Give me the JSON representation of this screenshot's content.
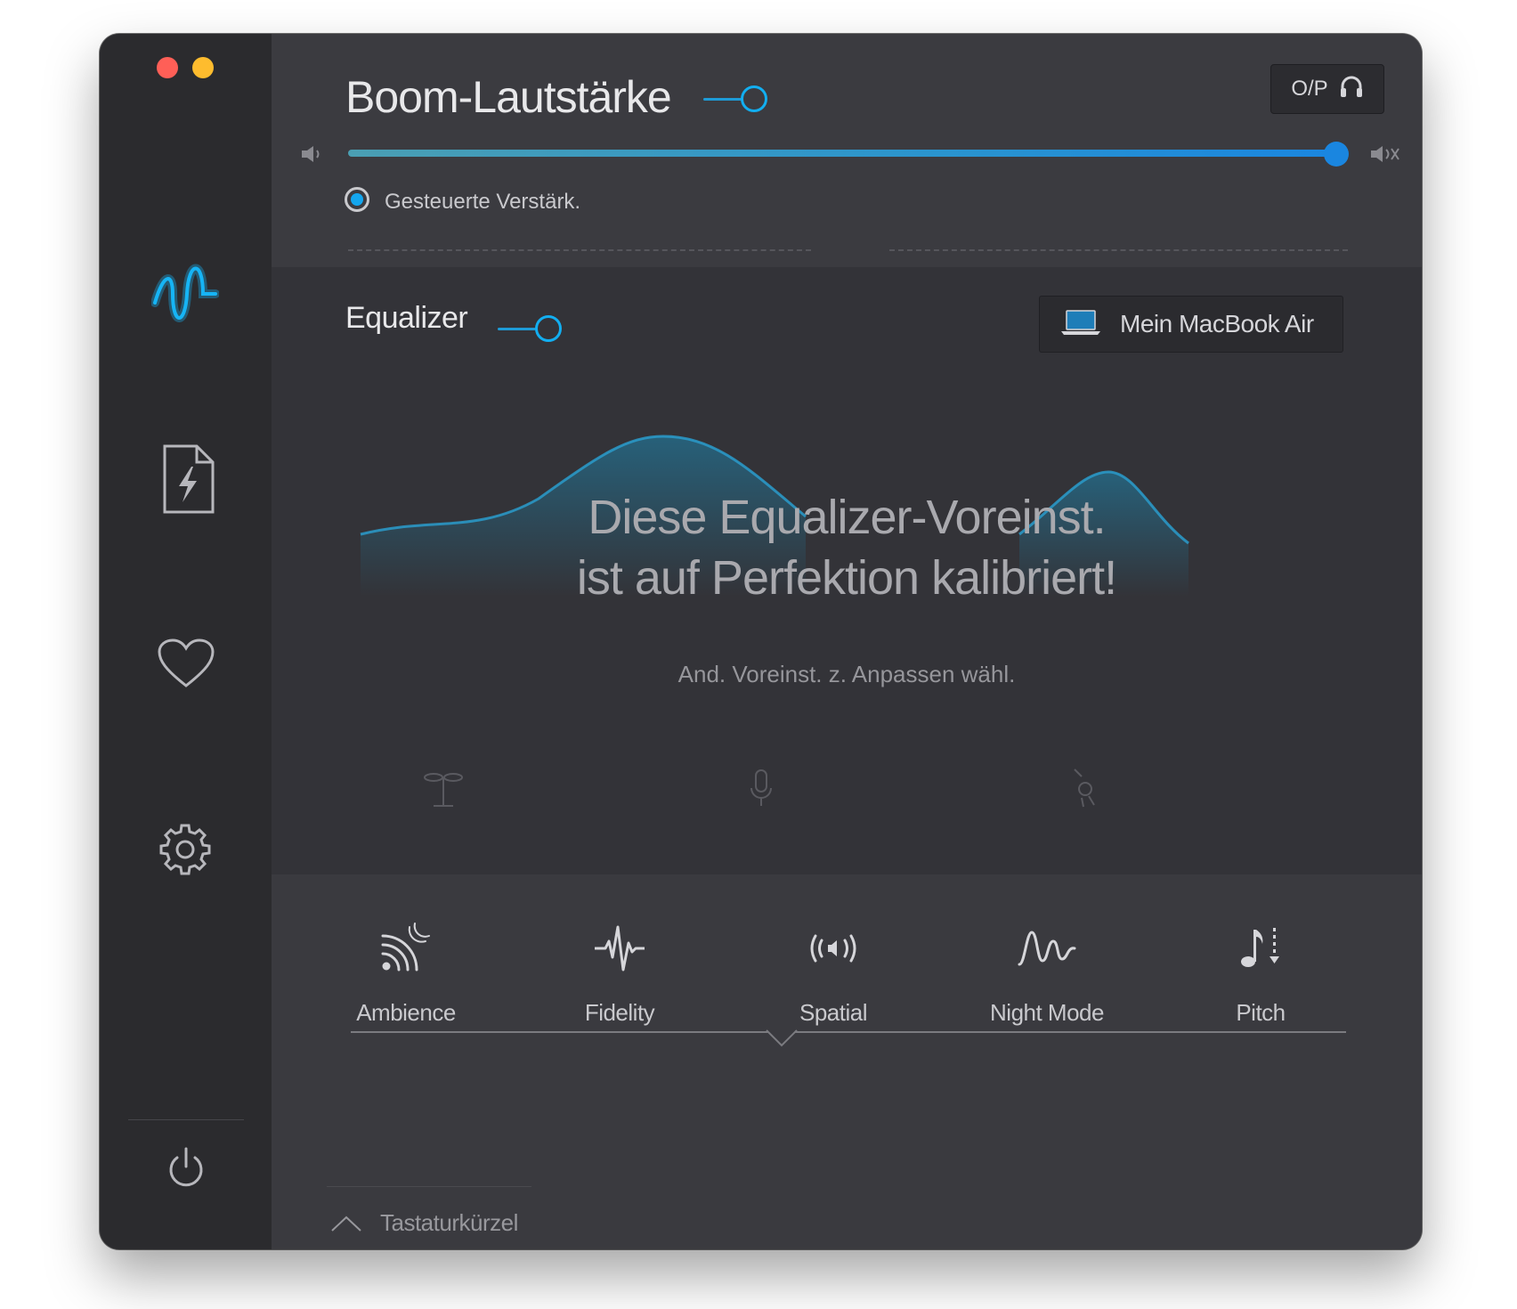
{
  "volume": {
    "title": "Boom-Lautstärke",
    "output_button": "O/P",
    "output_icon": "headphones-icon",
    "volume_level_percent": 99,
    "radio_label": "Gesteuerte Verstärk."
  },
  "equalizer": {
    "title": "Equalizer",
    "device_label": "Mein MacBook Air",
    "device_icon": "laptop-icon",
    "message_line1": "Diese Equalizer-Voreinst.",
    "message_line2": "ist auf Perfektion kalibriert!",
    "hint": "And. Voreinst. z. Anpassen wähl.",
    "preset_icons": [
      "drums-icon",
      "microphone-icon",
      "guitar-icon"
    ]
  },
  "effects": {
    "items": [
      {
        "label": "Ambience",
        "icon": "ambience-icon"
      },
      {
        "label": "Fidelity",
        "icon": "fidelity-icon"
      },
      {
        "label": "Spatial",
        "icon": "spatial-icon"
      },
      {
        "label": "Night Mode",
        "icon": "night-mode-icon"
      },
      {
        "label": "Pitch",
        "icon": "pitch-icon"
      }
    ]
  },
  "footer": {
    "shortcuts_label": "Tastaturkürzel"
  },
  "sidebar": {
    "items": [
      "equalizer-wave-icon",
      "file-boost-icon",
      "favorites-heart-icon",
      "settings-gear-icon",
      "power-icon"
    ]
  },
  "colors": {
    "accent": "#12aef0",
    "slider_blue": "#1a86e0",
    "close": "#ff5f57",
    "minimize": "#febc2e"
  }
}
